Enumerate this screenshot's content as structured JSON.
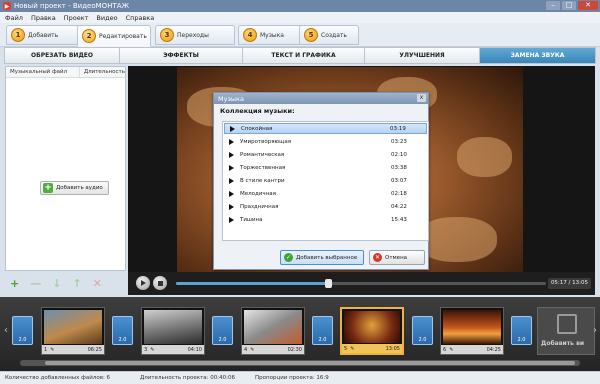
{
  "window": {
    "title": "Новый проект - ВидеоМОНТАЖ",
    "controls": [
      "–",
      "□",
      "✕"
    ]
  },
  "menu": [
    "Файл",
    "Правка",
    "Проект",
    "Видео",
    "Справка"
  ],
  "steps": [
    {
      "num": "1",
      "label": "Добавить"
    },
    {
      "num": "2",
      "label": "Редактировать"
    },
    {
      "num": "3",
      "label": "Переходы"
    },
    {
      "num": "4",
      "label": "Музыка"
    },
    {
      "num": "5",
      "label": "Создать"
    }
  ],
  "subtabs": [
    "ОБРЕЗАТЬ ВИДЕО",
    "ЭФФЕКТЫ",
    "ТЕКСТ И ГРАФИКА",
    "УЛУЧШЕНИЯ",
    "ЗАМЕНА ЗВУКА"
  ],
  "left_panel": {
    "columns": [
      "Музыкальный файл",
      "Длительность"
    ],
    "add_audio_label": "Добавить аудио",
    "actions": [
      "+",
      "—",
      "↓",
      "↑",
      "✕"
    ]
  },
  "dialog": {
    "title": "Музыка",
    "close": "x",
    "heading": "Коллекция музыки:",
    "tracks": [
      {
        "name": "Спокойная",
        "duration": "03:19"
      },
      {
        "name": "Умиротворяющая",
        "duration": "03:23"
      },
      {
        "name": "Романтическая",
        "duration": "02:10"
      },
      {
        "name": "Торжественная",
        "duration": "03:38"
      },
      {
        "name": "В стиле кантри",
        "duration": "03:07"
      },
      {
        "name": "Мелодичная",
        "duration": "02:18"
      },
      {
        "name": "Праздничная",
        "duration": "04:22"
      },
      {
        "name": "Тишина",
        "duration": "15:43"
      }
    ],
    "selected_index": 0,
    "add_button": "Добавить выбранное",
    "cancel_button": "Отмена"
  },
  "player": {
    "timecode": "05:17 / 13:05",
    "progress": 0.41
  },
  "timeline": {
    "transitions": [
      "2.0",
      "2.0",
      "2.0",
      "2.0",
      "2.0",
      "2.0"
    ],
    "clips": [
      {
        "num": "1",
        "duration": "06:25"
      },
      {
        "num": "3",
        "duration": "04:10"
      },
      {
        "num": "4",
        "duration": "02:30"
      },
      {
        "num": "5",
        "duration": "13:05"
      },
      {
        "num": "6",
        "duration": "04:25"
      }
    ],
    "active_clip": 3,
    "add_video_label": "Добавить ви"
  },
  "status": {
    "files": "Количество добавленных файлов: 6",
    "duration": "Длительность проекта: 00:40:06",
    "ratio": "Пропорции проекта: 16:9"
  },
  "colors": {
    "accent": "#3b86b8",
    "selection": "#b6d3f3",
    "active_clip": "#f0b23a"
  }
}
